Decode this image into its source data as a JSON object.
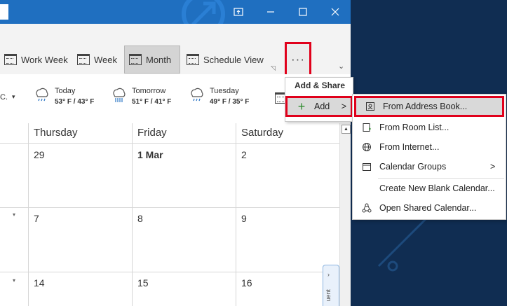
{
  "titlebar": {
    "restore_icon": "restore-window-icon",
    "minimize_icon": "minimize-icon",
    "maximize_icon": "maximize-icon",
    "close_icon": "close-icon"
  },
  "ribbon": {
    "views": [
      {
        "label": "Work Week",
        "active": false
      },
      {
        "label": "Week",
        "active": false
      },
      {
        "label": "Month",
        "active": true
      },
      {
        "label": "Schedule View",
        "active": false
      }
    ],
    "more_label": "···"
  },
  "weather": {
    "location_suffix": "C.",
    "days": [
      {
        "day": "Today",
        "temp": "53° F / 43° F"
      },
      {
        "day": "Tomorrow",
        "temp": "51° F / 41° F"
      },
      {
        "day": "Tuesday",
        "temp": "49° F / 35° F"
      }
    ]
  },
  "calendar": {
    "columns": [
      "Thursday",
      "Friday",
      "Saturday"
    ],
    "rows": [
      [
        "29",
        "1 Mar",
        "2"
      ],
      [
        "7",
        "8",
        "9"
      ],
      [
        "14",
        "15",
        "16"
      ]
    ],
    "side_tab": "uent"
  },
  "menu": {
    "header": "Add & Share",
    "add_label": "Add",
    "add_arrow": ">",
    "submenu": [
      {
        "label": "From Address Book...",
        "icon": "address-book-icon"
      },
      {
        "label": "From Room List...",
        "icon": "room-list-icon"
      },
      {
        "label": "From Internet...",
        "icon": "globe-icon"
      },
      {
        "label": "Calendar Groups",
        "icon": "calendar-groups-icon",
        "arrow": ">"
      },
      {
        "label": "Create New Blank Calendar...",
        "icon": ""
      },
      {
        "label": "Open Shared Calendar...",
        "icon": "shared-calendar-icon"
      }
    ]
  }
}
